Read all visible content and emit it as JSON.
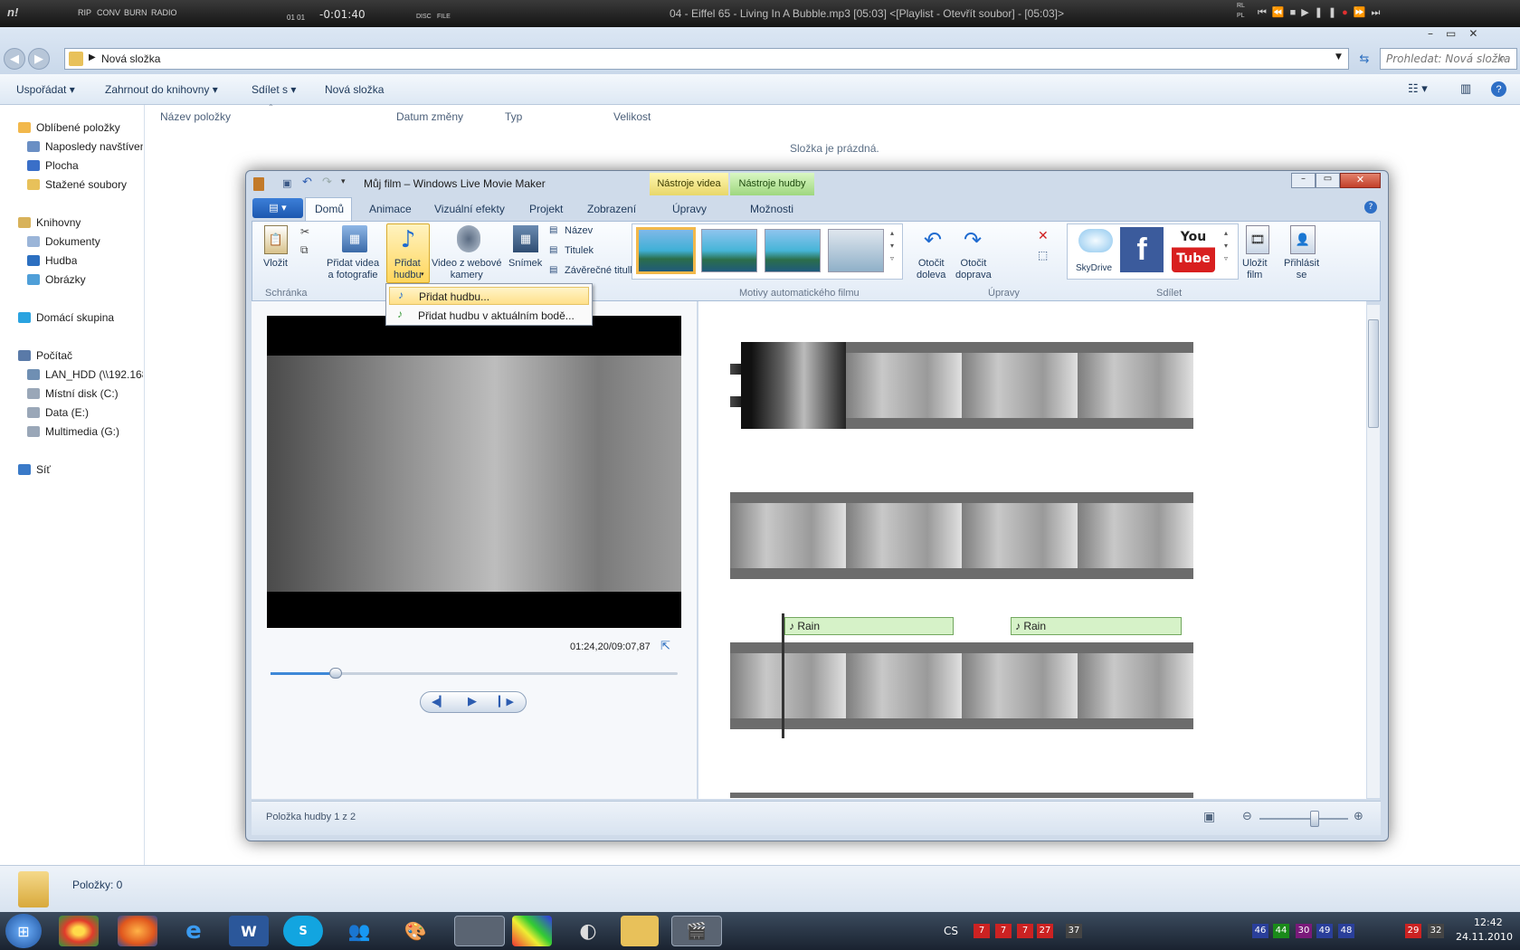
{
  "media_player": {
    "title": "04 - Eiffel 65 - Living In A Bubble.mp3  [05:03]    <[Playlist - Otevřít soubor] - [05:03]>",
    "time": "-0:01:40",
    "counters": "01  01",
    "buttons": [
      "RIP",
      "CONV",
      "BURN",
      "RADIO"
    ],
    "logo": "n!",
    "small": [
      "DISC",
      "FILE"
    ],
    "lang": [
      "RL",
      "PL"
    ]
  },
  "explorer": {
    "address": "Nová složka",
    "search_placeholder": "Prohledat: Nová složka",
    "toolbar": {
      "organize": "Uspořádat",
      "include": "Zahrnout do knihovny",
      "share": "Sdílet s",
      "new_folder": "Nová složka"
    },
    "columns": [
      "Název položky",
      "Datum změny",
      "Typ",
      "Velikost"
    ],
    "empty": "Složka je prázdná.",
    "status": "Položky: 0",
    "nav": [
      {
        "label": "Oblíbené položky",
        "icon": "star-icon"
      },
      {
        "label": "Naposledy navštívené",
        "icon": "recent-icon"
      },
      {
        "label": "Plocha",
        "icon": "desktop-icon"
      },
      {
        "label": "Stažené soubory",
        "icon": "download-folder-icon"
      },
      {
        "label": "Knihovny",
        "icon": "library-icon"
      },
      {
        "label": "Dokumenty",
        "icon": "documents-icon"
      },
      {
        "label": "Hudba",
        "icon": "music-icon"
      },
      {
        "label": "Obrázky",
        "icon": "pictures-icon"
      },
      {
        "label": "Domácí skupina",
        "icon": "homegroup-icon"
      },
      {
        "label": "Počítač",
        "icon": "computer-icon"
      },
      {
        "label": "LAN_HDD (\\\\192.168",
        "icon": "network-drive-icon"
      },
      {
        "label": "Místní disk (C:)",
        "icon": "disk-icon"
      },
      {
        "label": "Data  (E:)",
        "icon": "disk-icon"
      },
      {
        "label": "Multimedia (G:)",
        "icon": "disk-icon"
      },
      {
        "label": "Síť",
        "icon": "network-icon"
      }
    ]
  },
  "moviemaker": {
    "title": "Můj film – Windows Live Movie Maker",
    "context_tabs": [
      "Nástroje videa",
      "Nástroje hudby"
    ],
    "tabs": [
      "Domů",
      "Animace",
      "Vizuální efekty",
      "Projekt",
      "Zobrazení",
      "Úpravy",
      "Možnosti"
    ],
    "ribbon": {
      "paste": "Vložit",
      "add_video": "Přidat videa\na fotografie",
      "add_music": "Přidat\nhudbu",
      "webcam": "Video z webové\nkamery",
      "snapshot": "Snímek",
      "title": "Název",
      "caption": "Titulek",
      "credits": "Závěrečné titulky",
      "rotate_left": "Otočit\ndoleva",
      "rotate_right": "Otočit\ndoprava",
      "skydrive": "SkyDrive",
      "youtube": "You\nTube",
      "save": "Uložit\nfilm",
      "signin": "Přihlásit\nse",
      "groups": [
        "Schránka",
        "Motivy automatického filmu",
        "Úpravy",
        "Sdílet"
      ]
    },
    "menu": [
      "Přidat hudbu...",
      "Přidat hudbu v aktuálním bodě..."
    ],
    "timecode": "01:24,20/09:07,87",
    "playback_progress": 0.16,
    "zoom_level": 0.62,
    "music_clips": [
      "Rain",
      "Rain"
    ],
    "status": "Položka hudby 1 z 2"
  },
  "taskbar": {
    "lang": "CS",
    "time": "12:42",
    "date": "24.11.2010",
    "tray_numbers": [
      "7",
      "7",
      "7",
      "27",
      "37",
      "46",
      "44",
      "30",
      "49",
      "48",
      "29",
      "32"
    ]
  }
}
